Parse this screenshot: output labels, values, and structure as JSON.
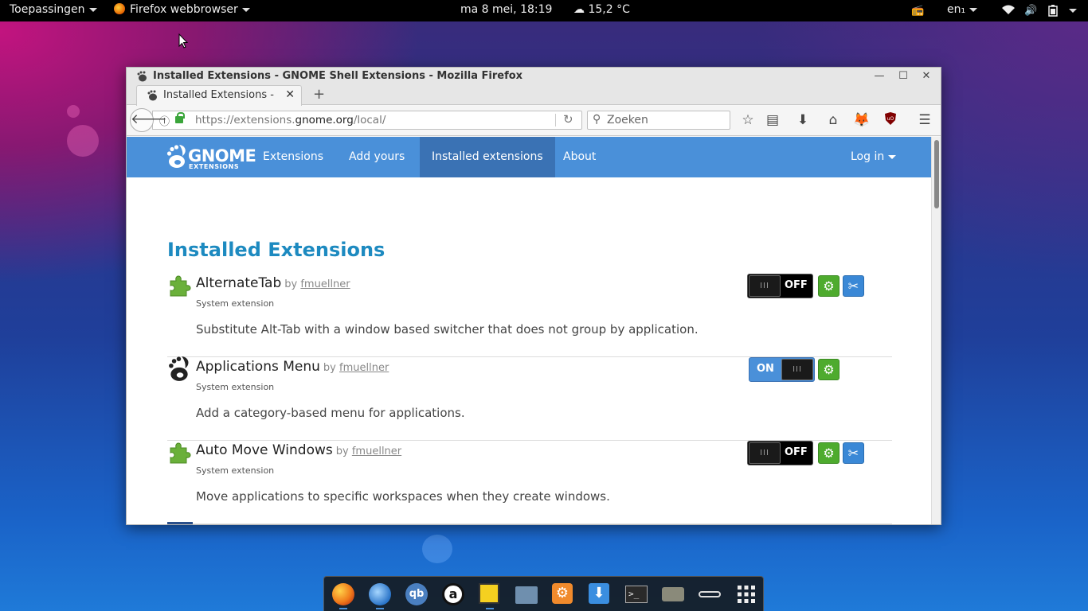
{
  "top_panel": {
    "apps_menu": "Toepassingen",
    "app_menu": "Firefox webbrowser",
    "clock": "ma  8 mei, 18:19",
    "weather": "15,2 °C",
    "keyboard": "en₁"
  },
  "window": {
    "title": "Installed Extensions - GNOME Shell Extensions - Mozilla Firefox",
    "tab_label": "Installed Extensions - G",
    "url_prefix": "https://extensions.",
    "url_domain": "gnome.org",
    "url_path": "/local/",
    "search_placeholder": "Zoeken"
  },
  "site_nav": {
    "logo_word": "GNOME",
    "logo_sub": "EXTENSIONS",
    "items": [
      "Extensions",
      "Add yours",
      "Installed extensions",
      "About"
    ],
    "login": "Log in"
  },
  "page": {
    "heading": "Installed Extensions",
    "extensions": [
      {
        "name": "AlternateTab",
        "by": "by",
        "author": "fmuellner",
        "type": "System extension",
        "description": "Substitute Alt-Tab with a window based switcher that does not group by application.",
        "state": "OFF",
        "has_prefs": true
      },
      {
        "name": "Applications Menu",
        "by": "by",
        "author": "fmuellner",
        "type": "System extension",
        "description": "Add a category-based menu for applications.",
        "state": "ON",
        "has_prefs": false
      },
      {
        "name": "Auto Move Windows",
        "by": "by",
        "author": "fmuellner",
        "type": "System extension",
        "description": "Move applications to specific workspaces when they create windows.",
        "state": "OFF",
        "has_prefs": true
      }
    ],
    "switch_knob": "III"
  },
  "dock": {
    "apps": [
      "firefox",
      "thunderbird",
      "qbittorrent",
      "amazon",
      "scratch-image",
      "files",
      "settings",
      "downloads",
      "terminal",
      "screenshot",
      "passwords",
      "app-grid"
    ]
  },
  "colors": {
    "gnome_blue": "#4a90d9",
    "gnome_blue_active": "#3a72b4",
    "heading": "#1d8ac0",
    "green_button": "#4eab2e"
  }
}
